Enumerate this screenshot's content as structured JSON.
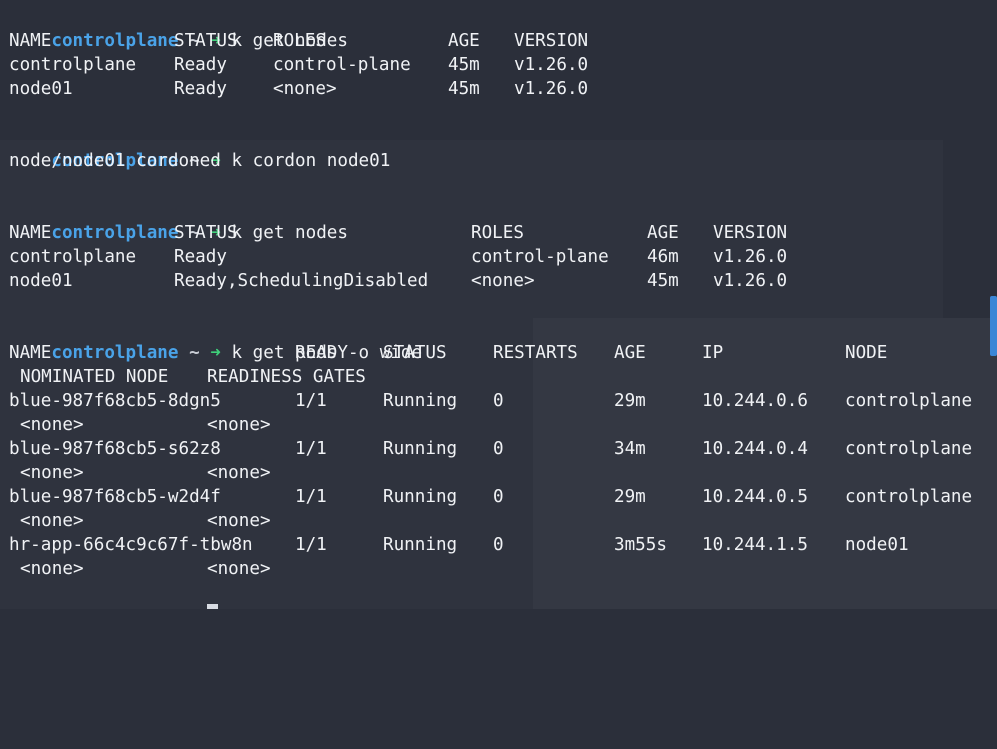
{
  "prompt": {
    "host": "controlplane",
    "tilde": "~",
    "arrow": "➜"
  },
  "cmd1": {
    "command": "k get nodes",
    "headers": [
      "NAME",
      "STATUS",
      "ROLES",
      "AGE",
      "VERSION"
    ],
    "rows": [
      [
        "controlplane",
        "Ready",
        "control-plane",
        "45m",
        "v1.26.0"
      ],
      [
        "node01",
        "Ready",
        "<none>",
        "45m",
        "v1.26.0"
      ]
    ]
  },
  "cmd2": {
    "command": "k cordon node01",
    "output": "node/node01 cordoned"
  },
  "cmd3": {
    "command": "k get nodes",
    "headers": [
      "NAME",
      "STATUS",
      "ROLES",
      "AGE",
      "VERSION"
    ],
    "rows": [
      [
        "controlplane",
        "Ready",
        "control-plane",
        "46m",
        "v1.26.0"
      ],
      [
        "node01",
        "Ready,SchedulingDisabled",
        "<none>",
        "45m",
        "v1.26.0"
      ]
    ]
  },
  "cmd4": {
    "command": "k get pods -o wide",
    "headers": [
      "NAME",
      "READY",
      "STATUS",
      "RESTARTS",
      "AGE",
      "IP",
      "NODE"
    ],
    "headers2": [
      "NOMINATED NODE",
      "READINESS GATES"
    ],
    "rows": [
      [
        "blue-987f68cb5-8dgn5",
        "1/1",
        "Running",
        "0",
        "29m",
        "10.244.0.6",
        "controlplane",
        "<none>",
        "<none>"
      ],
      [
        "blue-987f68cb5-s62z8",
        "1/1",
        "Running",
        "0",
        "34m",
        "10.244.0.4",
        "controlplane",
        "<none>",
        "<none>"
      ],
      [
        "blue-987f68cb5-w2d4f",
        "1/1",
        "Running",
        "0",
        "29m",
        "10.244.0.5",
        "controlplane",
        "<none>",
        "<none>"
      ],
      [
        "hr-app-66c4c9c67f-tbw8n",
        "1/1",
        "Running",
        "0",
        "3m55s",
        "10.244.1.5",
        "node01",
        "<none>",
        "<none>"
      ]
    ]
  },
  "colors": {
    "background": "#2b2f3a",
    "text": "#f0f2f5",
    "prompt_host": "#4aa3e8",
    "prompt_arrow": "#3fd07a",
    "scrollbar": "#3b86d6"
  }
}
